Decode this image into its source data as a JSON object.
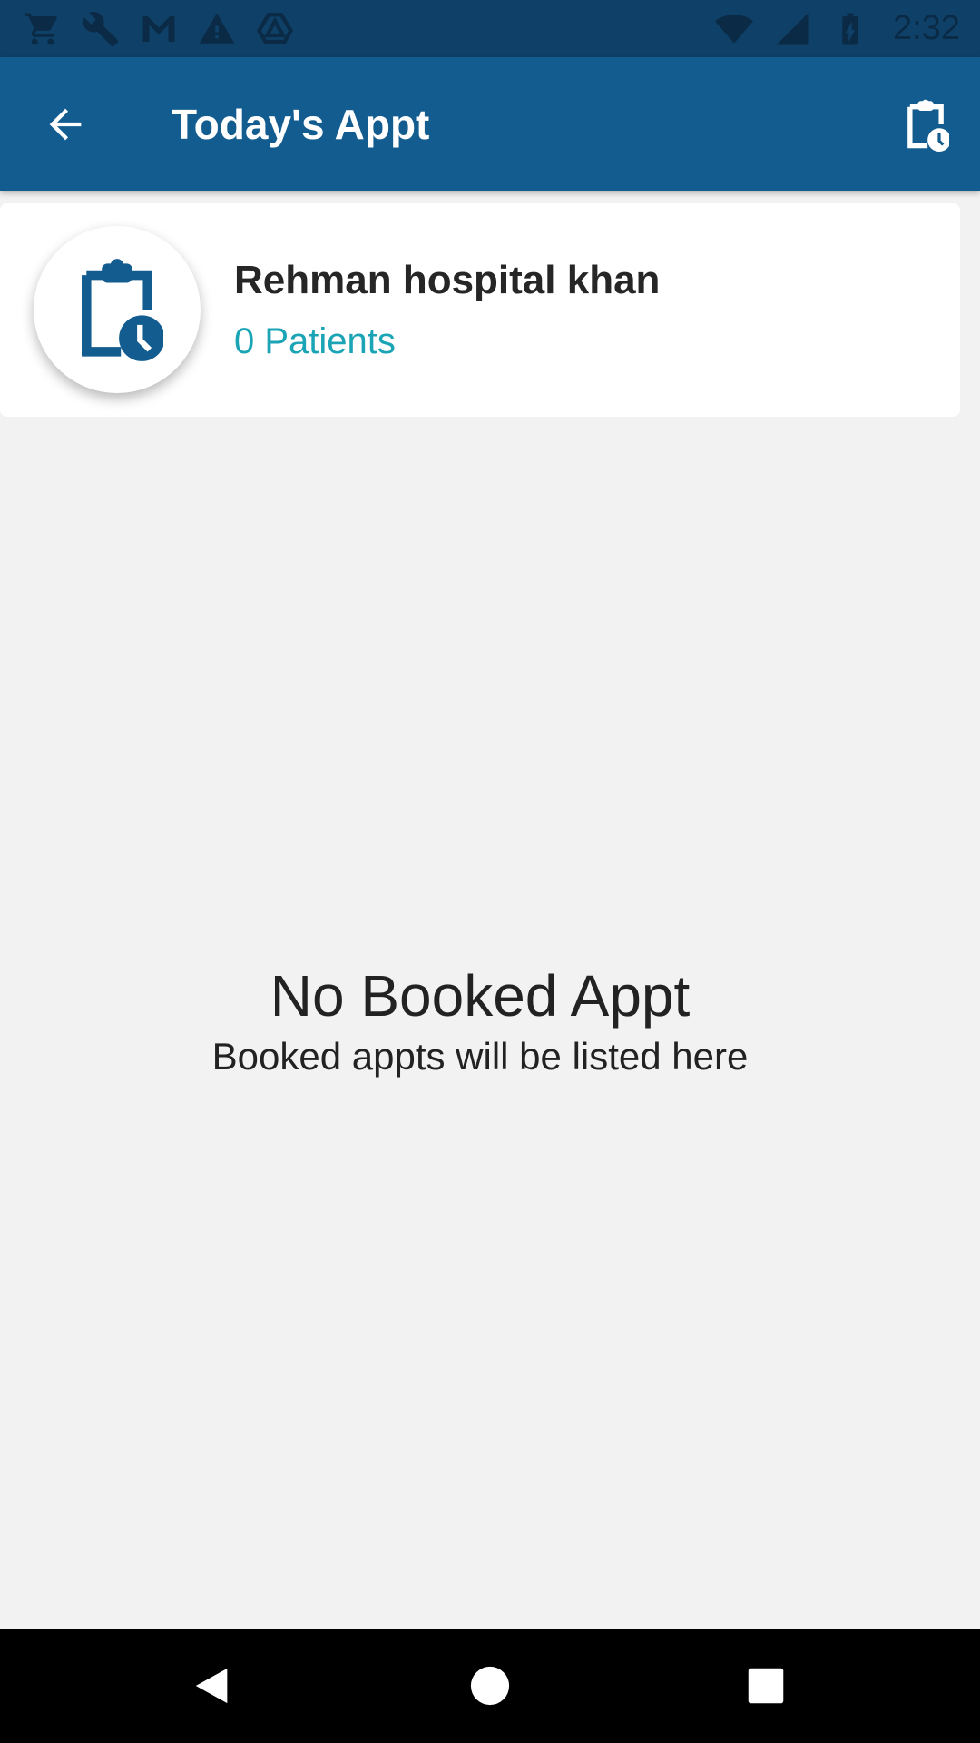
{
  "status_bar": {
    "time": "2:32",
    "left_icons": [
      "cart-icon",
      "wrench-icon",
      "gmail-icon",
      "warning-icon",
      "drive-icon"
    ],
    "right_icons": [
      "wifi-icon",
      "signal-icon",
      "battery-icon"
    ]
  },
  "app_bar": {
    "title": "Today's Appt",
    "back_icon": "arrow-left-icon",
    "action_icon": "clipboard-clock-icon"
  },
  "clinic_card": {
    "name": "Rehman hospital khan",
    "patients": "0 Patients",
    "icon": "clipboard-clock-icon"
  },
  "empty_state": {
    "title": "No Booked Appt",
    "subtitle": "Booked appts will be listed here"
  },
  "nav_bar": {
    "icons": [
      "back-triangle-icon",
      "home-circle-icon",
      "recents-square-icon"
    ]
  },
  "colors": {
    "status_bar": "#0f4068",
    "app_bar": "#135c8f",
    "accent_teal": "#1aa4b5",
    "background": "#f2f2f2"
  }
}
